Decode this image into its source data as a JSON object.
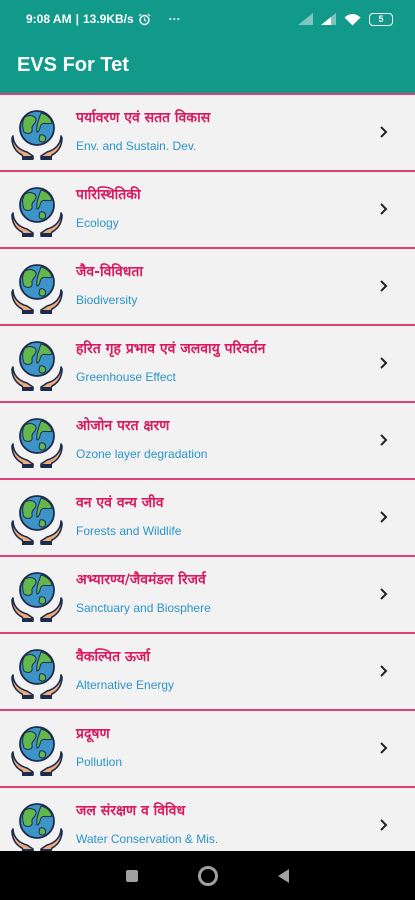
{
  "status_bar": {
    "time": "9:08 AM",
    "separator": "|",
    "speed": "13.9KB/s",
    "overflow": "···",
    "battery": "5"
  },
  "app_bar": {
    "title": "EVS For Tet"
  },
  "colors": {
    "primary": "#11998a",
    "divider": "#dd3f7a",
    "title_text": "#d81b60",
    "subtitle_text": "#2c93c9"
  },
  "icons": {
    "row_icon": "globe-in-hands-icon",
    "row_chevron": "chevron-right-icon"
  },
  "topics": [
    {
      "title": "पर्यावरण एवं सतत विकास",
      "subtitle": "Env. and Sustain. Dev."
    },
    {
      "title": "पारिस्थितिकी",
      "subtitle": "Ecology"
    },
    {
      "title": "जैव-विविधता",
      "subtitle": "Biodiversity"
    },
    {
      "title": "हरित गृह प्रभाव एवं जलवायु परिवर्तन",
      "subtitle": "Greenhouse Effect"
    },
    {
      "title": "ओजोन परत क्षरण",
      "subtitle": "Ozone layer degradation"
    },
    {
      "title": "वन एवं वन्य जीव",
      "subtitle": "Forests and Wildlife"
    },
    {
      "title": "अभ्यारण्य/जैवमंडल रिजर्व",
      "subtitle": "Sanctuary and Biosphere"
    },
    {
      "title": "वैकल्पित ऊर्जा",
      "subtitle": "Alternative Energy"
    },
    {
      "title": "प्रदूषण",
      "subtitle": "Pollution"
    },
    {
      "title": "जल संरक्षण व विविध",
      "subtitle": "Water Conservation & Mis."
    }
  ]
}
